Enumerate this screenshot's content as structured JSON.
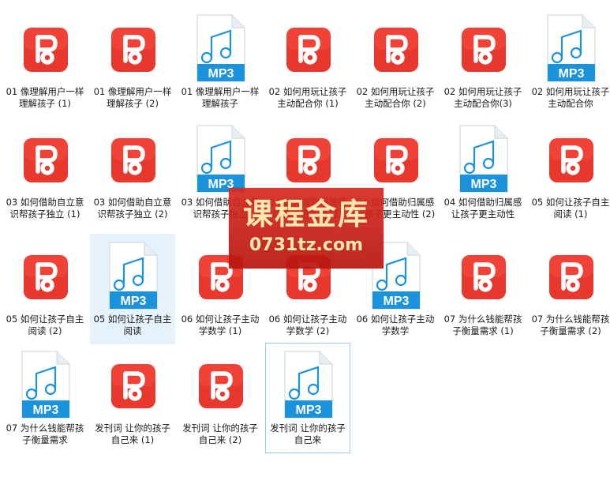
{
  "colors": {
    "pdf_red": "#e8372c",
    "mp3_blue": "#1a93dc",
    "selection": "#e5f1fb",
    "watermark": "#c81e16"
  },
  "files": [
    {
      "name": "01 像理解用户一样理解孩子 (1)",
      "type": "pdf"
    },
    {
      "name": "01 像理解用户一样理解孩子 (2)",
      "type": "pdf"
    },
    {
      "name": "01 像理解用户一样理解孩子",
      "type": "mp3",
      "badge": "MP3"
    },
    {
      "name": "02 如何用玩让孩子主动配合你 (1)",
      "type": "pdf"
    },
    {
      "name": "02 如何用玩让孩子主动配合你 (2)",
      "type": "pdf"
    },
    {
      "name": "02 如何用玩让孩子主动配合你(3)",
      "type": "pdf"
    },
    {
      "name": "02 如何用玩让孩子主动配合你",
      "type": "mp3",
      "badge": "MP3"
    },
    {
      "name": "03 如何借助自立意识帮孩子独立 (1)",
      "type": "pdf"
    },
    {
      "name": "03 如何借助自立意识帮孩子独立 (2)",
      "type": "pdf"
    },
    {
      "name": "03 如何借助自立意识帮孩子独立",
      "type": "mp3",
      "badge": "MP3"
    },
    {
      "name": "04 如何借助归属感让孩子更主动 (1)",
      "type": "pdf"
    },
    {
      "name": "04 如何借助归属感让孩子更主动性 (2)",
      "type": "pdf"
    },
    {
      "name": "04 如何借助归属感让孩子更主动性",
      "type": "mp3",
      "badge": "MP3"
    },
    {
      "name": "05 如何让孩子自主阅读 (1)",
      "type": "pdf"
    },
    {
      "name": "05 如何让孩子自主阅读 (2)",
      "type": "pdf"
    },
    {
      "name": "05 如何让孩子自主阅读",
      "type": "mp3",
      "badge": "MP3",
      "selected": true
    },
    {
      "name": "06 如何让孩子主动学数学 (1)",
      "type": "pdf"
    },
    {
      "name": "06 如何让孩子主动学数学 (2)",
      "type": "pdf"
    },
    {
      "name": "06 如何让孩子主动学数学",
      "type": "mp3",
      "badge": "MP3"
    },
    {
      "name": "07 为什么钱能帮孩子衡量需求 (1)",
      "type": "pdf"
    },
    {
      "name": "07 为什么钱能帮孩子衡量需求 (2)",
      "type": "pdf"
    },
    {
      "name": "07 为什么钱能帮孩子衡量需求",
      "type": "mp3",
      "badge": "MP3"
    },
    {
      "name": "发刊词  让你的孩子自己来 (1)",
      "type": "pdf"
    },
    {
      "name": "发刊词  让你的孩子自己来 (2)",
      "type": "pdf"
    },
    {
      "name": "发刊词  让你的孩子自己来",
      "type": "mp3",
      "badge": "MP3",
      "focused": true
    }
  ],
  "watermark": {
    "title": "课程金库",
    "url": "0731tz.com"
  }
}
